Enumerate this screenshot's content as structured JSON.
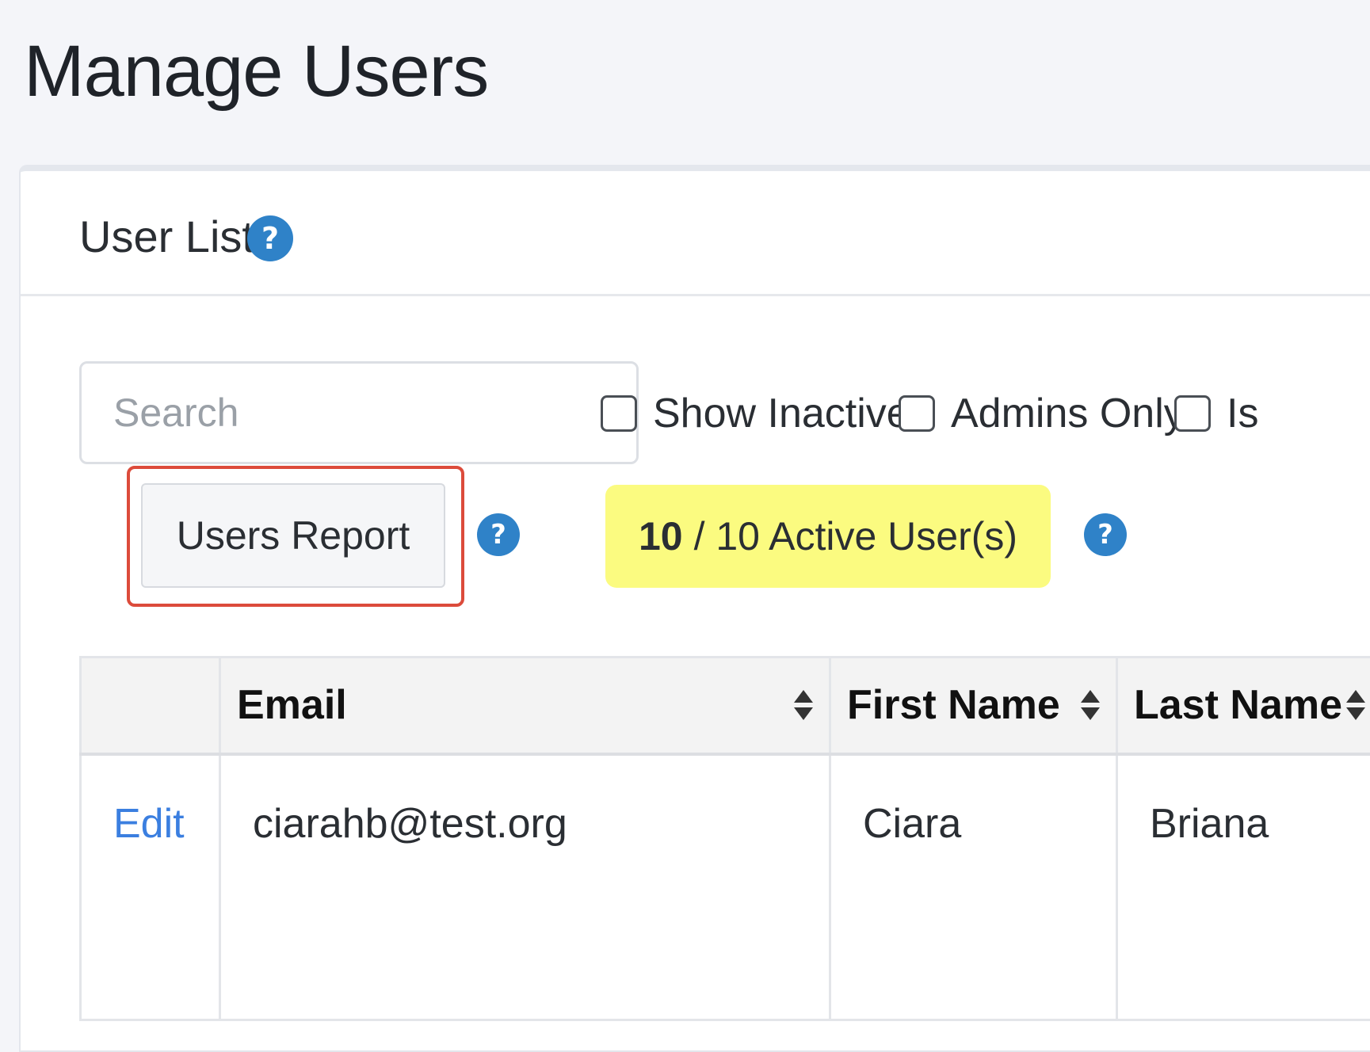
{
  "page": {
    "title": "Manage Users"
  },
  "card": {
    "title": "User List",
    "help_icon": "?"
  },
  "search": {
    "placeholder": "Search",
    "value": ""
  },
  "filters": [
    {
      "label": "Show Inactive",
      "checked": false
    },
    {
      "label": "Admins Only",
      "checked": false
    },
    {
      "label": "Is",
      "checked": false
    }
  ],
  "toolbar": {
    "report_label": "Users Report",
    "report_help_icon": "?",
    "active_count": "10",
    "active_suffix": "/ 10 Active User(s)",
    "active_help_icon": "?"
  },
  "table": {
    "columns": [
      "",
      "Email",
      "First Name",
      "Last Name"
    ],
    "rows": [
      {
        "action": "Edit",
        "email": "ciarahb@test.org",
        "first_name": "Ciara",
        "last_name": "Briana"
      }
    ]
  },
  "colors": {
    "accent": "#2f82c8",
    "link": "#3b7fe0",
    "badge_bg": "#fbfb80",
    "highlight": "#dc4b3b"
  },
  "icons": {
    "help": "question-circle-icon",
    "sort": "sort-icon",
    "checkbox": "checkbox-icon"
  }
}
